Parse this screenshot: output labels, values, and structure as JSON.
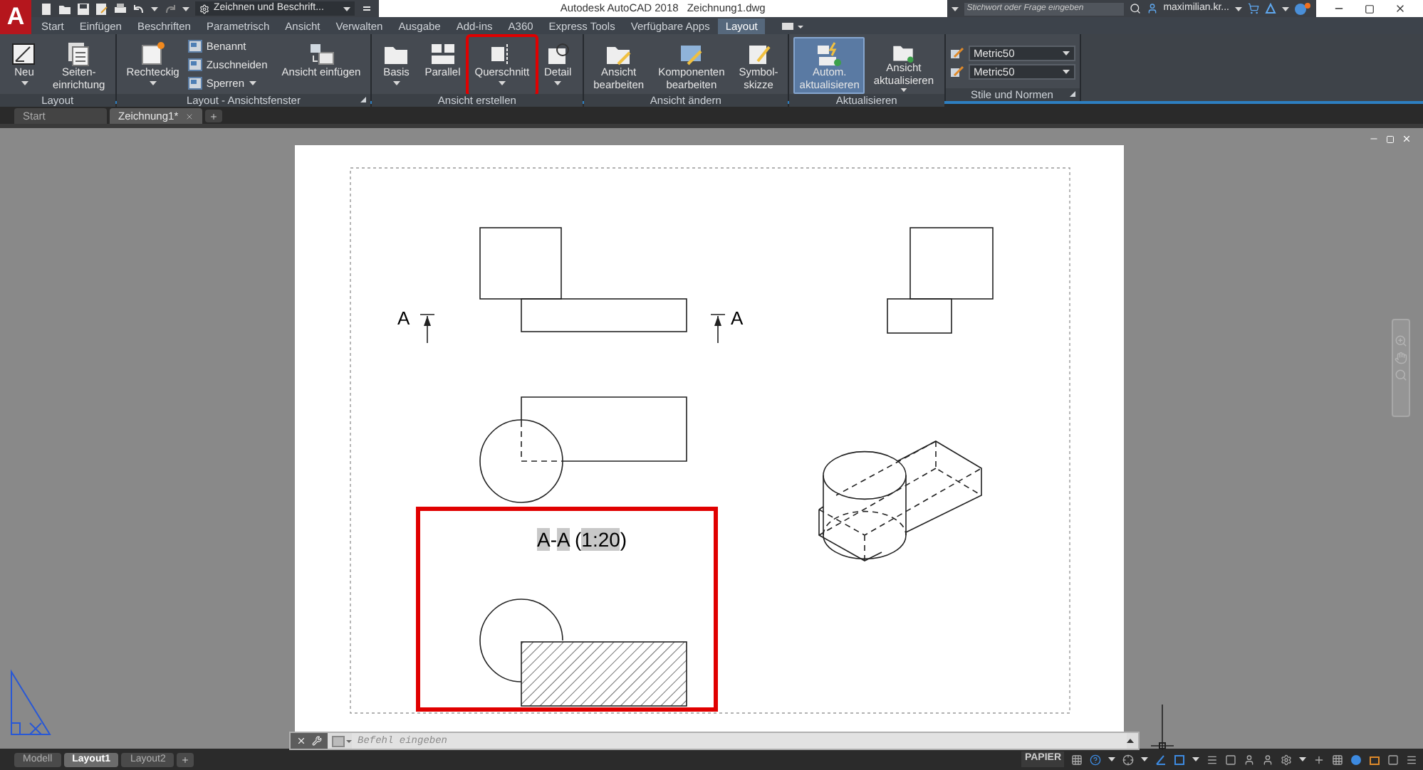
{
  "logo": "A",
  "quick_access": {
    "workspace": "Zeichnen und Beschrift..."
  },
  "title_bar": {
    "title": "Autodesk AutoCAD 2018",
    "file": "Zeichnung1.dwg",
    "search": {
      "placeholder": "Stichwort oder Frage eingeben"
    },
    "user": "maximilian.kr..."
  },
  "ribbon_tabs": [
    {
      "label": "Start",
      "selected": false
    },
    {
      "label": "Einfügen",
      "selected": false
    },
    {
      "label": "Beschriften",
      "selected": false
    },
    {
      "label": "Parametrisch",
      "selected": false
    },
    {
      "label": "Ansicht",
      "selected": false
    },
    {
      "label": "Verwalten",
      "selected": false
    },
    {
      "label": "Ausgabe",
      "selected": false
    },
    {
      "label": "Add-ins",
      "selected": false
    },
    {
      "label": "A360",
      "selected": false
    },
    {
      "label": "Express Tools",
      "selected": false
    },
    {
      "label": "Verfügbare Apps",
      "selected": false
    },
    {
      "label": "Layout",
      "selected": true
    }
  ],
  "ribbon_panels": [
    {
      "title": "Layout",
      "launcher": false,
      "tools": [
        {
          "kind": "large",
          "label": "Neu",
          "dropdown": true,
          "on": false,
          "marked": false
        },
        {
          "kind": "large",
          "label": "Seiten-\neinrichtung",
          "dropdown": false,
          "on": false,
          "marked": false
        }
      ]
    },
    {
      "title": "Layout - Ansichtsfenster",
      "launcher": true,
      "tools": [
        {
          "kind": "large",
          "label": "Rechteckig",
          "dropdown": true,
          "on": false,
          "marked": false
        },
        {
          "kind": "stack",
          "items": [
            {
              "label": "Benannt",
              "dropdown": false
            },
            {
              "label": "Zuschneiden",
              "dropdown": false
            },
            {
              "label": "Sperren",
              "dropdown": true
            }
          ]
        },
        {
          "kind": "large",
          "label": "Ansicht einfügen",
          "dropdown": false,
          "on": false,
          "marked": false
        }
      ]
    },
    {
      "title": "Ansicht erstellen",
      "launcher": false,
      "tools": [
        {
          "kind": "large",
          "label": "Basis",
          "dropdown": true,
          "on": false,
          "marked": false
        },
        {
          "kind": "large",
          "label": "Parallel",
          "dropdown": false,
          "on": false,
          "marked": false
        },
        {
          "kind": "large",
          "label": "Querschnitt",
          "dropdown": true,
          "on": false,
          "marked": true
        },
        {
          "kind": "large",
          "label": "Detail",
          "dropdown": true,
          "on": false,
          "marked": false
        }
      ]
    },
    {
      "title": "Ansicht ändern",
      "launcher": false,
      "tools": [
        {
          "kind": "large",
          "label": "Ansicht\nbearbeiten",
          "dropdown": false,
          "on": false,
          "marked": false
        },
        {
          "kind": "large",
          "label": "Komponenten\nbearbeiten",
          "dropdown": false,
          "on": false,
          "marked": false
        },
        {
          "kind": "large",
          "label": "Symbol-\nskizze",
          "dropdown": false,
          "on": false,
          "marked": false
        }
      ]
    },
    {
      "title": "Aktualisieren",
      "launcher": false,
      "tools": [
        {
          "kind": "large",
          "label": "Autom.\naktualisieren",
          "dropdown": false,
          "on": true,
          "marked": false
        },
        {
          "kind": "large",
          "label": "Ansicht\naktualisieren",
          "dropdown": true,
          "on": false,
          "marked": false
        }
      ]
    },
    {
      "title": "Stile und Normen",
      "launcher": true,
      "tools": [
        {
          "kind": "select",
          "value": "Metric50"
        },
        {
          "kind": "select",
          "value": "Metric50"
        }
      ]
    }
  ],
  "document_tabs": [
    {
      "label": "Start",
      "selected": false,
      "closable": false
    },
    {
      "label": "Zeichnung1*",
      "selected": true,
      "closable": true
    }
  ],
  "drawing": {
    "section_markers": [
      {
        "label": "A"
      },
      {
        "label": "A"
      }
    ],
    "section_view": {
      "highlighted": true,
      "label": [
        {
          "text": "A",
          "highlight": true
        },
        {
          "text": "-",
          "highlight": false
        },
        {
          "text": "A",
          "highlight": true
        },
        {
          "text": " (",
          "highlight": false
        },
        {
          "text": "1:20",
          "highlight": true
        },
        {
          "text": ")",
          "highlight": false
        }
      ]
    }
  },
  "command_line": {
    "placeholder": "Befehl eingeben"
  },
  "layout_tabs": [
    {
      "label": "Modell",
      "selected": false
    },
    {
      "label": "Layout1",
      "selected": true
    },
    {
      "label": "Layout2",
      "selected": false
    }
  ],
  "status_bar": {
    "space": "PAPIER"
  }
}
